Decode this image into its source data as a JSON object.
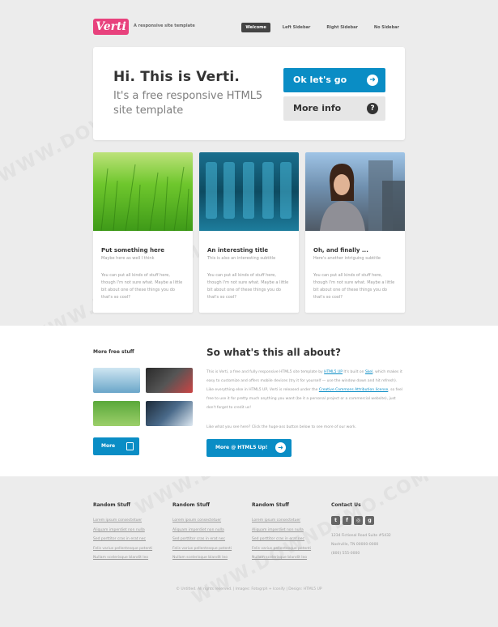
{
  "header": {
    "logo": "Verti",
    "tagline": "A responsive site template",
    "nav": [
      "Welcome",
      "Left Sidebar",
      "Right Sidebar",
      "No Sidebar"
    ]
  },
  "banner": {
    "title": "Hi. This is Verti.",
    "subtitle": "It's a free responsive HTML5 site template",
    "primary_button": "Ok let's go",
    "secondary_button": "More info"
  },
  "features": [
    {
      "title": "Put something here",
      "subtitle": "Maybe here as well I think",
      "body": "You can put all kinds of stuff here, though I'm not sure what. Maybe a little bit about one of these things you do that's so cool?"
    },
    {
      "title": "An interesting title",
      "subtitle": "This is also an interesting subtitle",
      "body": "You can put all kinds of stuff here, though I'm not sure what. Maybe a little bit about one of these things you do that's so cool?"
    },
    {
      "title": "Oh, and finally ...",
      "subtitle": "Here's another intriguing subtitle",
      "body": "You can put all kinds of stuff here, though I'm not sure what. Maybe a little bit about one of these things you do that's so cool?"
    }
  ],
  "sidebar": {
    "title": "More free stuff",
    "more_button": "More"
  },
  "about": {
    "title": "So what's this all about?",
    "paragraph1_pre": "This is Verti, a free and fully responsive HTML5 site template by ",
    "link1": "HTML5 UP",
    "paragraph1_mid": " It's built on ",
    "link2": "Skel",
    "paragraph1_rest": ", which makes it easy to customize and offers mobile devices (try it for yourself — use the window down and hit refresh). Like everything else in HTML5 UP, Verti is released under the ",
    "link3": "Creative Commons Attribution license",
    "paragraph1_end": ", so feel free to use it for pretty much anything you want (be it a personal project or a commercial website), just don't forget to credit us!",
    "paragraph2": "Like what you see here? Click the huge-ass button below to see more of our work.",
    "button": "More @ HTML5 Up!"
  },
  "footer": {
    "columns": [
      {
        "title": "Random Stuff",
        "links": [
          "Lorem ipsum consectetuer",
          "Aliquam imperdiet non nulla",
          "Sed porttitor cras in erat nec",
          "Felis varius pellentesque potenti",
          "Nullam scelerisque blandit leo"
        ]
      },
      {
        "title": "Random Stuff",
        "links": [
          "Lorem ipsum consectetuer",
          "Aliquam imperdiet non nulla",
          "Sed porttitor cras in erat nec",
          "Felis varius pellentesque potenti",
          "Nullam scelerisque blandit leo"
        ]
      },
      {
        "title": "Random Stuff",
        "links": [
          "Lorem ipsum consectetuer",
          "Aliquam imperdiet non nulla",
          "Sed porttitor cras in erat nec",
          "Felis varius pellentesque potenti",
          "Nullam scelerisque blandit leo"
        ]
      }
    ],
    "contact": {
      "title": "Contact Us",
      "address_line1": "1234 Fictional Road Suite #5432",
      "address_line2": "Nashville, TN 00000-0000",
      "phone": "(800) 555-0000"
    },
    "copyright": "© Untitled. All rights reserved. | Images: Fotogrph + Iconify | Design: HTML5 UP"
  },
  "watermark": "WWW.DOWNDEMO.COM",
  "colors": {
    "accent": "#0a8dc5",
    "logo": "#e8427d",
    "background": "#ececec"
  }
}
